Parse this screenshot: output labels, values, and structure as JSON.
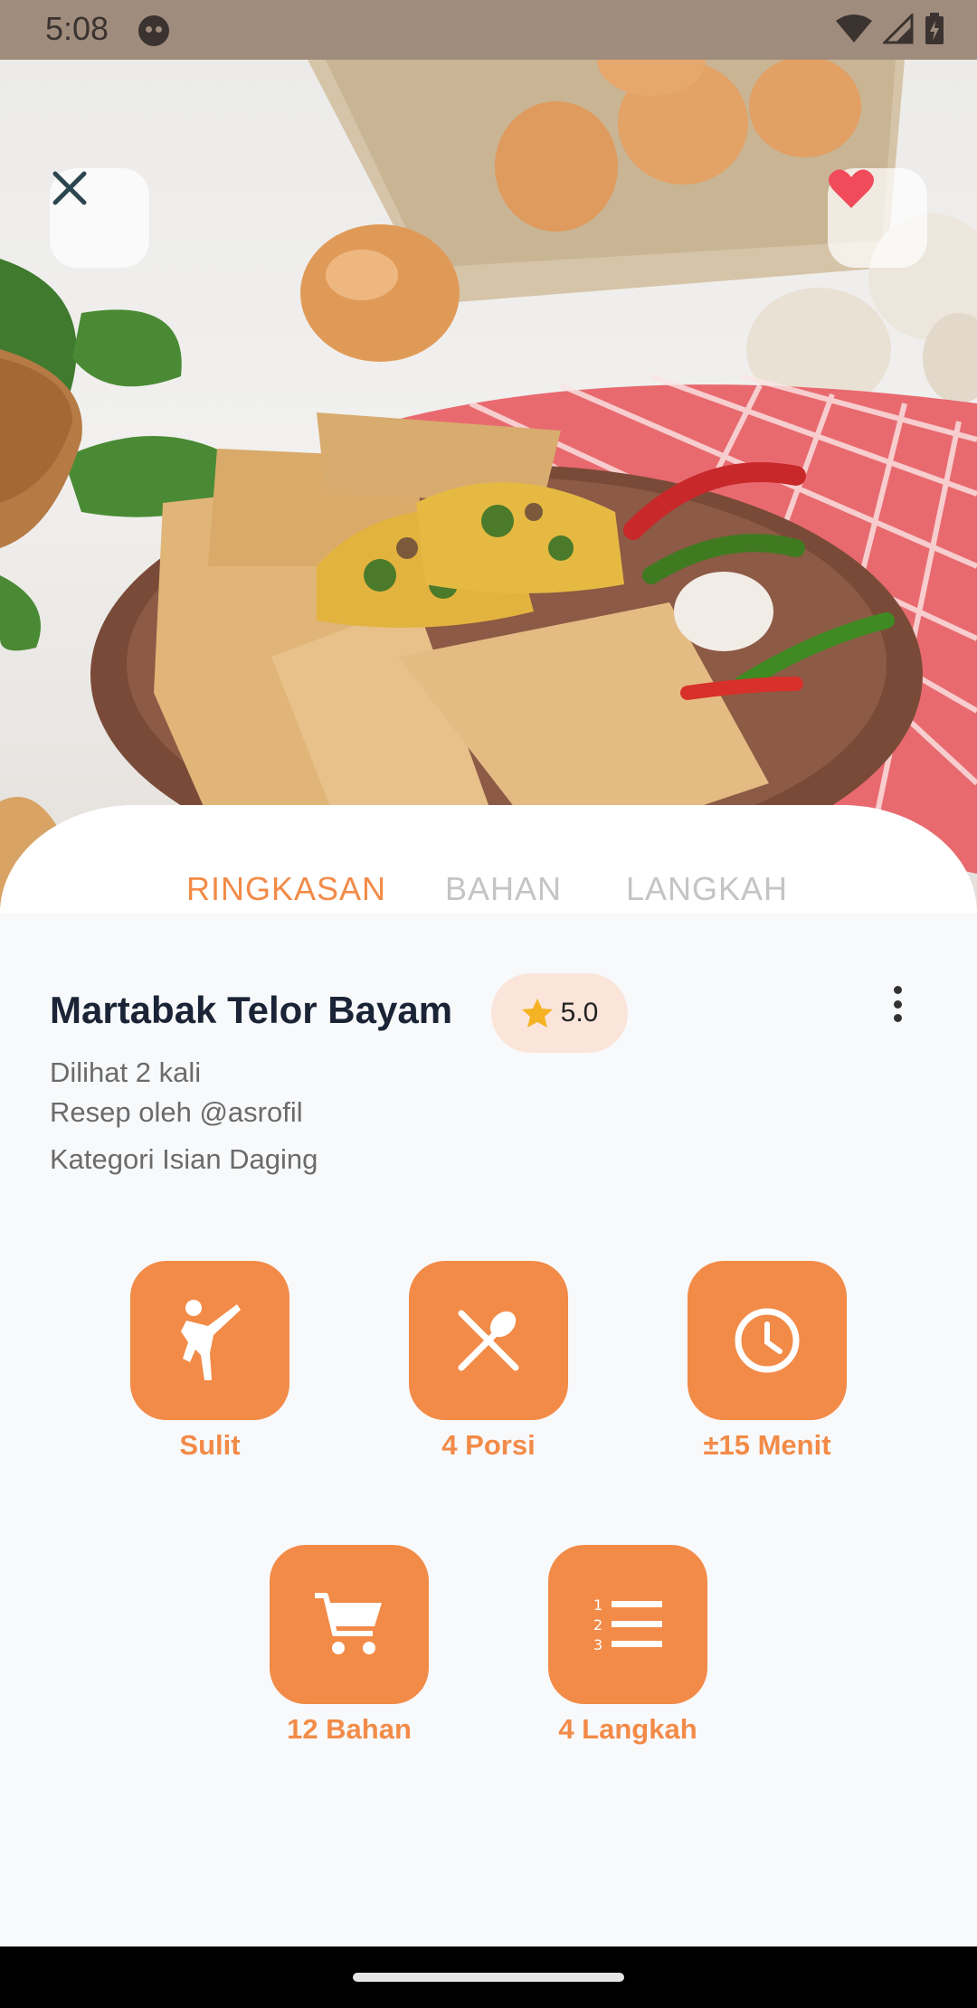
{
  "status_bar": {
    "time": "5:08"
  },
  "recipe": {
    "title": "Martabak Telor Bayam",
    "rating": "5.0",
    "views": "Dilihat 2 kali",
    "author": "Resep oleh @asrofil",
    "category": "Kategori Isian Daging"
  },
  "tabs": [
    {
      "label": "RINGKASAN",
      "active": true
    },
    {
      "label": "BAHAN",
      "active": false
    },
    {
      "label": "LANGKAH",
      "active": false
    }
  ],
  "stats": [
    {
      "label": "Sulit",
      "icon": "martial-arts-icon"
    },
    {
      "label": "4 Porsi",
      "icon": "utensils-icon"
    },
    {
      "label": "±15 Menit",
      "icon": "clock-icon"
    },
    {
      "label": "12 Bahan",
      "icon": "cart-icon"
    },
    {
      "label": "4 Langkah",
      "icon": "numbered-list-icon"
    }
  ],
  "colors": {
    "accent": "#f28b48",
    "favorite": "#f14a5a",
    "status_bar": "#a08c7d"
  }
}
